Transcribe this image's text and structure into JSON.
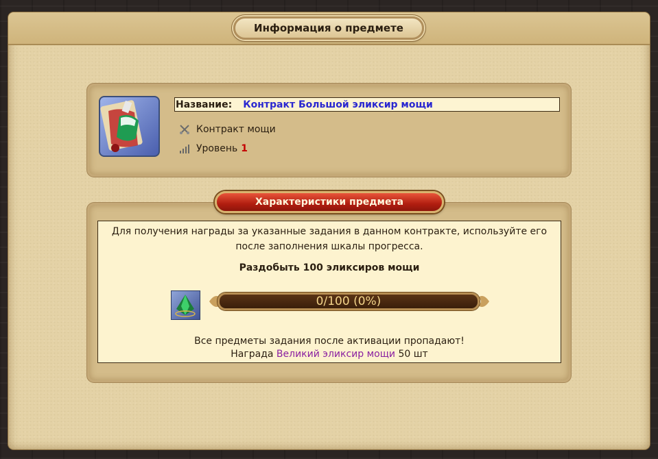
{
  "window": {
    "title": "Информация о предмете"
  },
  "item": {
    "name_label": "Название:",
    "name_value": "Контракт Большой эликсир мощи",
    "type_label": "Контракт мощи",
    "level_label": "Уровень",
    "level_value": "1",
    "icon": "contract-elixir-icon"
  },
  "stats": {
    "header": "Характеристики предмета",
    "description_line1": "Для получения награды за указанные задания в данном контракте, используйте его",
    "description_line2": "после заполнения шкалы прогресса.",
    "task_title": "Раздобыть 100 эликсиров мощи",
    "task_icon": "green-crystal-icon",
    "progress_text": "0/100 (0%)",
    "progress_fraction": 0,
    "note": "Все предметы задания после активации пропадают!",
    "reward_prefix": "Награда",
    "reward_name": "Великий эликсир мощи",
    "reward_suffix": "50 шт"
  },
  "colors": {
    "item_name": "#2a27d0",
    "level": "#c40000",
    "reward": "#8a1fa0",
    "header_red": "#b11e10"
  }
}
